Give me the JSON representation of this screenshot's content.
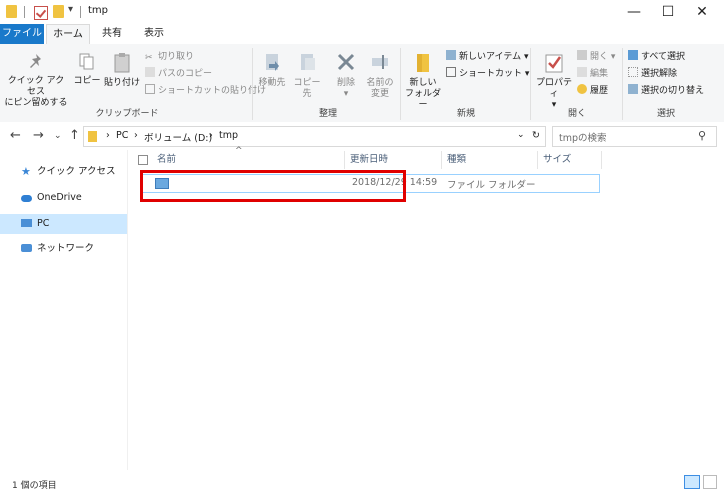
{
  "window": {
    "title": "tmp",
    "controls": {
      "minimize": "—",
      "maximize": "☐",
      "close": "✕"
    }
  },
  "tabs": [
    {
      "label": "ファイル"
    },
    {
      "label": "ホーム"
    },
    {
      "label": "共有"
    },
    {
      "label": "表示"
    }
  ],
  "ribbon": {
    "clipboard": {
      "pin_label_1": "クイック アクセス",
      "pin_label_2": "にピン留めする",
      "copy": "コピー",
      "paste": "貼り付け",
      "cut": "切り取り",
      "copy_path": "パスのコピー",
      "paste_shortcut": "ショートカットの貼り付け",
      "group": "クリップボード"
    },
    "organize": {
      "move_to": "移動先",
      "copy_to": "コピー先",
      "delete": "削除",
      "rename_1": "名前の",
      "rename_2": "変更",
      "group": "整理"
    },
    "new": {
      "new_folder_1": "新しい",
      "new_folder_2": "フォルダー",
      "new_item": "新しいアイテム ▾",
      "shortcut": "ショートカット ▾",
      "group": "新規"
    },
    "open": {
      "properties": "プロパティ",
      "open": "開く ▾",
      "edit": "編集",
      "history": "履歴",
      "group": "開く"
    },
    "select": {
      "select_all": "すべて選択",
      "select_none": "選択解除",
      "invert": "選択の切り替え",
      "group": "選択"
    }
  },
  "address": {
    "crumbs": [
      "PC",
      "ボリューム (D:)",
      "tmp"
    ],
    "search_placeholder": "tmpの検索"
  },
  "nav_pane": [
    {
      "label": "クイック アクセス",
      "icon": "star-icon"
    },
    {
      "label": "OneDrive",
      "icon": "cloud-icon"
    },
    {
      "label": "PC",
      "icon": "computer-icon",
      "selected": true
    },
    {
      "label": "ネットワーク",
      "icon": "network-icon"
    }
  ],
  "columns": [
    "名前",
    "更新日時",
    "種類",
    "サイズ"
  ],
  "rows": [
    {
      "name": "",
      "modified": "2018/12/29 14:59",
      "type": "ファイル フォルダー",
      "size": ""
    }
  ],
  "status": {
    "count": "1 個の項目"
  }
}
